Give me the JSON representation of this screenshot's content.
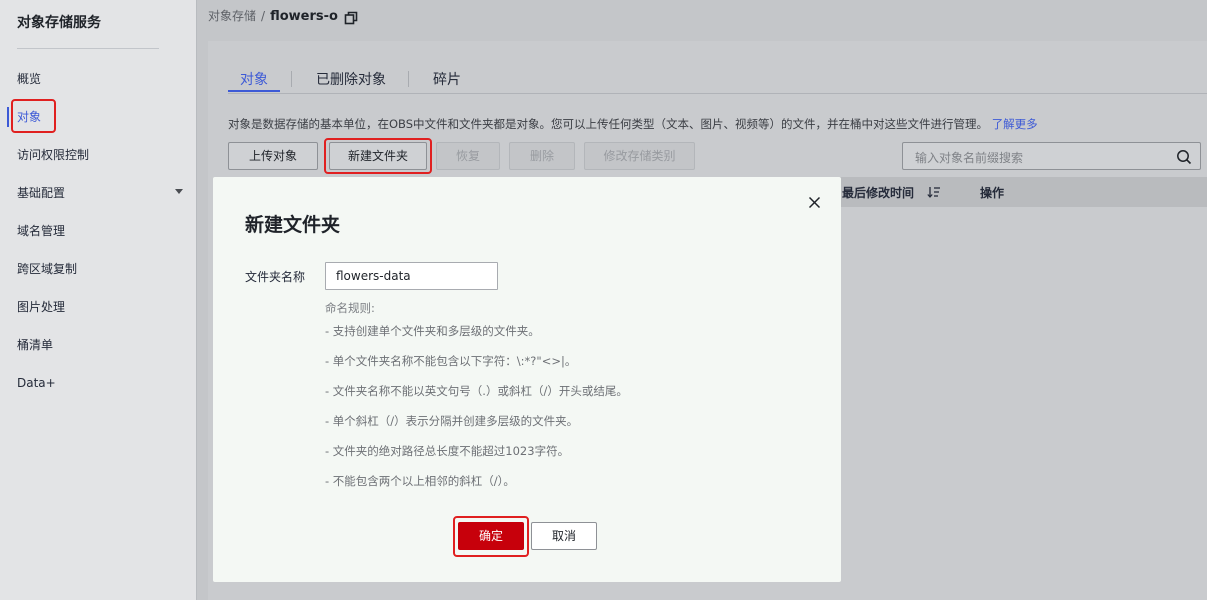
{
  "sidebar": {
    "title": "对象存储服务",
    "items": [
      {
        "label": "概览"
      },
      {
        "label": "对象"
      },
      {
        "label": "访问权限控制"
      },
      {
        "label": "基础配置"
      },
      {
        "label": "域名管理"
      },
      {
        "label": "跨区域复制"
      },
      {
        "label": "图片处理"
      },
      {
        "label": "桶清单"
      },
      {
        "label": "Data+"
      }
    ],
    "active": "对象"
  },
  "breadcrumb": {
    "parent": "对象存储",
    "separator": "/",
    "current": "flowers-o"
  },
  "tabs": [
    {
      "label": "对象"
    },
    {
      "label": "已删除对象"
    },
    {
      "label": "碎片"
    }
  ],
  "description": {
    "text": "对象是数据存储的基本单位，在OBS中文件和文件夹都是对象。您可以上传任何类型（文本、图片、视频等）的文件，并在桶中对这些文件进行管理。",
    "link": "了解更多"
  },
  "toolbar": {
    "upload": "上传对象",
    "new_folder": "新建文件夹",
    "restore": "恢复",
    "delete": "删除",
    "change_storage": "修改存储类别"
  },
  "search": {
    "placeholder": "输入对象名前缀搜索"
  },
  "table": {
    "headers": {
      "last_modified": "最后修改时间",
      "actions": "操作"
    }
  },
  "modal": {
    "title": "新建文件夹",
    "field_label": "文件夹名称",
    "field_value": "flowers-data",
    "rules_title": "命名规则:",
    "rules": [
      "-  支持创建单个文件夹和多层级的文件夹。",
      "-  单个文件夹名称不能包含以下字符：\\:*?\"<>|。",
      "-  文件夹名称不能以英文句号（.）或斜杠（/）开头或结尾。",
      "-  单个斜杠（/）表示分隔并创建多层级的文件夹。",
      "-  文件夹的绝对路径总长度不能超过1023字符。",
      "-  不能包含两个以上相邻的斜杠（/）。"
    ],
    "ok": "确定",
    "cancel": "取消"
  },
  "colors": {
    "accent": "#3d5ad6",
    "primary_button": "#c7000b",
    "highlight_box": "#e02020"
  }
}
